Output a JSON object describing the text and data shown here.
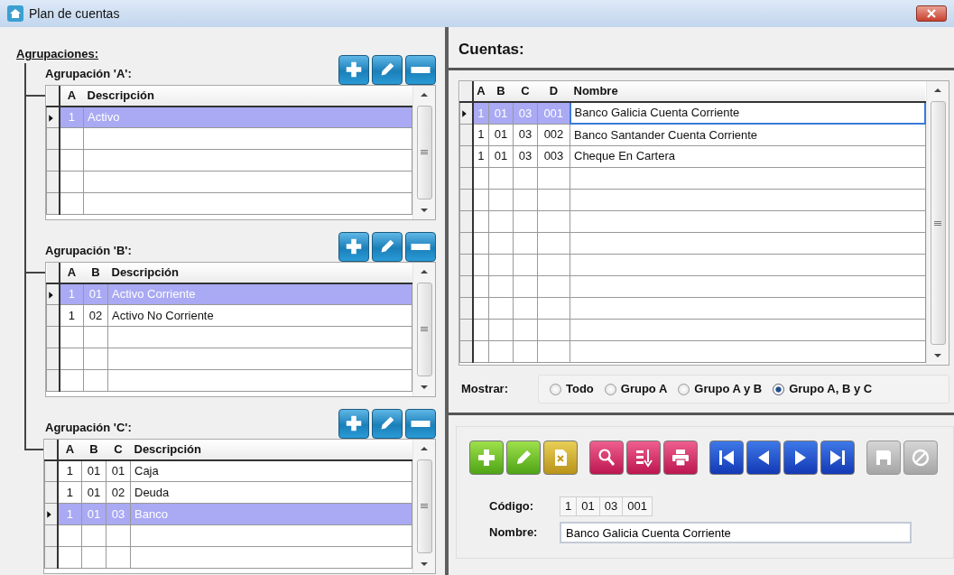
{
  "window": {
    "title": "Plan de cuentas"
  },
  "agrupaciones": {
    "title": "Agrupaciones:",
    "groups": [
      {
        "title": "Agrupación 'A':",
        "columns": [
          "A",
          "Descripción"
        ],
        "rows": [
          {
            "cells": [
              "1",
              "Activo"
            ],
            "selected": true
          }
        ]
      },
      {
        "title": "Agrupación 'B':",
        "columns": [
          "A",
          "B",
          "Descripción"
        ],
        "rows": [
          {
            "cells": [
              "1",
              "01",
              "Activo Corriente"
            ],
            "selected": true
          },
          {
            "cells": [
              "1",
              "02",
              "Activo No Corriente"
            ],
            "selected": false
          }
        ]
      },
      {
        "title": "Agrupación 'C':",
        "columns": [
          "A",
          "B",
          "C",
          "Descripción"
        ],
        "rows": [
          {
            "cells": [
              "1",
              "01",
              "01",
              "Caja"
            ],
            "selected": false
          },
          {
            "cells": [
              "1",
              "01",
              "02",
              "Deuda"
            ],
            "selected": false
          },
          {
            "cells": [
              "1",
              "01",
              "03",
              "Banco"
            ],
            "selected": true
          }
        ]
      }
    ]
  },
  "cuentas": {
    "title": "Cuentas:",
    "columns": [
      "A",
      "B",
      "C",
      "D",
      "Nombre"
    ],
    "rows": [
      {
        "cells": [
          "1",
          "01",
          "03",
          "001",
          "Banco Galicia Cuenta Corriente"
        ],
        "selected": true
      },
      {
        "cells": [
          "1",
          "01",
          "03",
          "002",
          "Banco Santander Cuenta Corriente"
        ],
        "selected": false
      },
      {
        "cells": [
          "1",
          "01",
          "03",
          "003",
          "Cheque En Cartera"
        ],
        "selected": false
      }
    ],
    "mostrar": {
      "label": "Mostrar:",
      "options": [
        {
          "label": "Todo",
          "selected": false
        },
        {
          "label": "Grupo A",
          "selected": false
        },
        {
          "label": "Grupo A y B",
          "selected": false
        },
        {
          "label": "Grupo A, B y C",
          "selected": true
        }
      ]
    }
  },
  "toolbar": [
    {
      "kind": "add",
      "disabled": false
    },
    {
      "kind": "edit",
      "disabled": false
    },
    {
      "kind": "clear",
      "disabled": false
    },
    {
      "kind": "search",
      "disabled": false
    },
    {
      "kind": "sort",
      "disabled": false
    },
    {
      "kind": "print",
      "disabled": false
    },
    {
      "kind": "first",
      "disabled": false
    },
    {
      "kind": "previous",
      "disabled": false
    },
    {
      "kind": "next",
      "disabled": false
    },
    {
      "kind": "last",
      "disabled": false
    },
    {
      "kind": "save",
      "disabled": true
    },
    {
      "kind": "cancel",
      "disabled": true
    }
  ],
  "form": {
    "codigo": {
      "label": "Código:",
      "parts": [
        "1",
        "01",
        "03",
        "001"
      ]
    },
    "nombre": {
      "label": "Nombre:",
      "value": "Banco Galicia Cuenta Corriente"
    }
  }
}
